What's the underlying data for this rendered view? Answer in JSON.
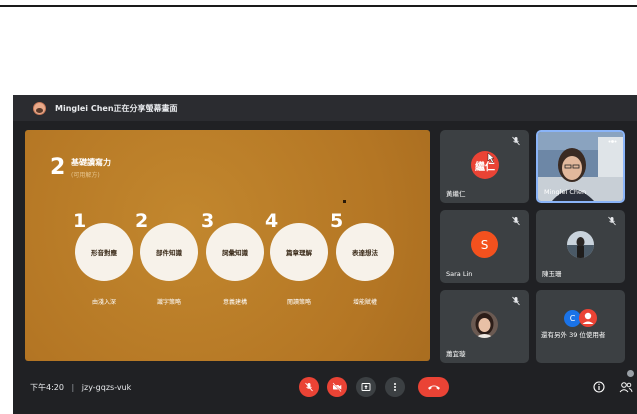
{
  "share": {
    "text": "Minglei Chen正在分享螢幕畫面"
  },
  "slide": {
    "number": "2",
    "title": "基礎讀寫力",
    "subtitle": "(可用解方)",
    "steps": [
      {
        "num": "1",
        "circle": "形音對應",
        "label": "由淺入深"
      },
      {
        "num": "2",
        "circle": "部件知識",
        "label": "識字策略"
      },
      {
        "num": "3",
        "circle": "詞彙知識",
        "label": "意義建構"
      },
      {
        "num": "4",
        "circle": "篇章理解",
        "label": "閱讀策略"
      },
      {
        "num": "5",
        "circle": "表達想法",
        "label": "增能賦權"
      }
    ]
  },
  "participants": {
    "p1": {
      "name": "黃繼仁",
      "avatar_text": "繼仁",
      "avatar_color": "#ea4335"
    },
    "p2": {
      "name": "Minglei Chen"
    },
    "p3": {
      "name": "Sara Lin",
      "avatar_text": "S",
      "avatar_color": "#f4511e"
    },
    "p4": {
      "name": "陳玉珊"
    },
    "p5": {
      "name": "蕭宜璇"
    },
    "p6": {
      "name": "還有另外 39 位使用者",
      "avatar_text": "C",
      "avatar_color": "#1a73e8"
    }
  },
  "bottom": {
    "time": "下午4:20",
    "meeting_code": "jzy-gqzs-vuk"
  },
  "colors": {
    "accent_red": "#ea4335",
    "tile_bg": "#3c4043",
    "meet_bg": "#202124",
    "slide_bg": "#b87b26"
  }
}
